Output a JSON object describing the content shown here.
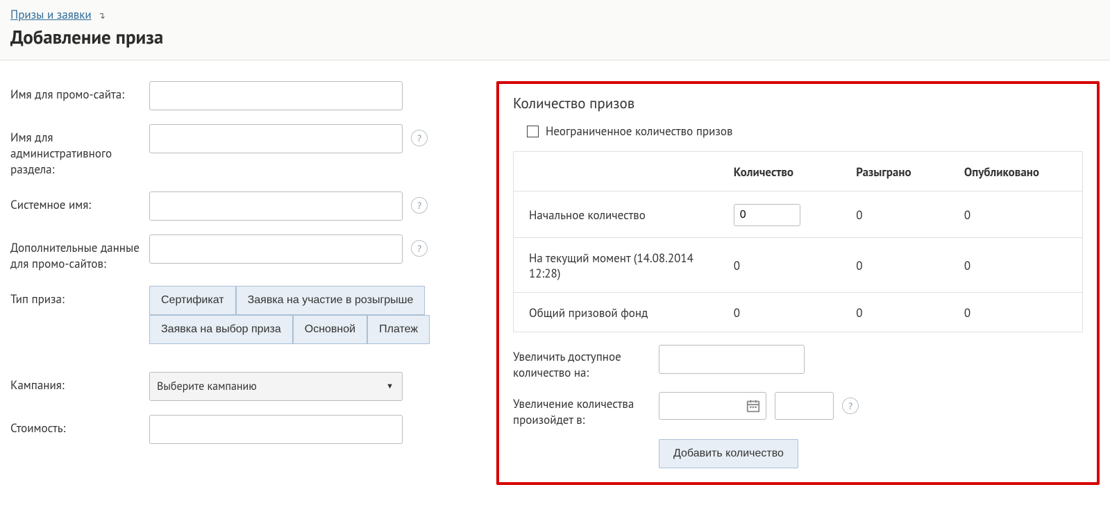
{
  "breadcrumb": {
    "link": "Призы и заявки"
  },
  "page_title": "Добавление приза",
  "form": {
    "promo_name": {
      "label": "Имя для промо-сайта:",
      "value": ""
    },
    "admin_name": {
      "label": "Имя для административного раздела:",
      "value": ""
    },
    "system_name": {
      "label": "Системное имя:",
      "value": ""
    },
    "extra_data": {
      "label": "Дополнительные данные для промо-сайтов:",
      "value": ""
    },
    "prize_type": {
      "label": "Тип приза:",
      "options": [
        "Сертификат",
        "Заявка на участие в розыгрыше",
        "Заявка на выбор приза",
        "Основной",
        "Платеж"
      ]
    },
    "campaign": {
      "label": "Кампания:",
      "placeholder": "Выберите кампанию"
    },
    "cost": {
      "label": "Стоимость:",
      "value": ""
    }
  },
  "panel": {
    "title": "Количество призов",
    "unlimited_label": "Неограниченное количество призов",
    "table": {
      "headers": [
        "",
        "Количество",
        "Разыграно",
        "Опубликовано"
      ],
      "rows": [
        {
          "label": "Начальное количество",
          "qty": "0",
          "drawn": "0",
          "published": "0",
          "editable": true
        },
        {
          "label": "На текущий момент (14.08.2014 12:28)",
          "qty": "0",
          "drawn": "0",
          "published": "0",
          "editable": false
        },
        {
          "label": "Общий призовой фонд",
          "qty": "0",
          "drawn": "0",
          "published": "0",
          "editable": false
        }
      ]
    },
    "increase_by": {
      "label": "Увеличить доступное количество на:",
      "value": ""
    },
    "increase_at": {
      "label": "Увеличение количества произойдет в:",
      "date": "",
      "time": ""
    },
    "add_btn": "Добавить количество"
  }
}
